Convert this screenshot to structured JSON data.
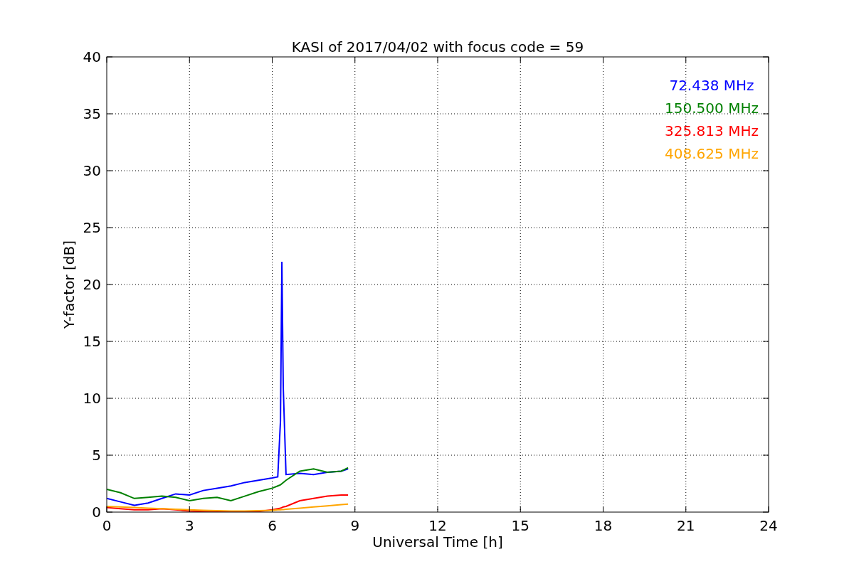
{
  "chart_data": {
    "type": "line",
    "title": "KASI of 2017/04/02 with focus code = 59",
    "xlabel": "Universal Time [h]",
    "ylabel": "Y-factor [dB]",
    "x": [
      0,
      0.5,
      1,
      1.5,
      2,
      2.5,
      3,
      3.5,
      4,
      4.5,
      5,
      5.5,
      6,
      6.2,
      6.3,
      6.35,
      6.4,
      6.5,
      7,
      7.5,
      8,
      8.5,
      8.75
    ],
    "series": [
      {
        "name": "72.438 MHz",
        "color": "#0000ff",
        "values": [
          1.2,
          0.9,
          0.6,
          0.8,
          1.2,
          1.6,
          1.5,
          1.9,
          2.1,
          2.3,
          2.6,
          2.8,
          3.0,
          3.1,
          8,
          22,
          11,
          3.3,
          3.4,
          3.3,
          3.5,
          3.6,
          3.8
        ]
      },
      {
        "name": "150.500 MHz",
        "color": "#008000",
        "values": [
          2.0,
          1.7,
          1.2,
          1.3,
          1.4,
          1.3,
          1.0,
          1.2,
          1.3,
          1.0,
          1.4,
          1.8,
          2.1,
          2.3,
          2.4,
          2.5,
          2.6,
          2.8,
          3.6,
          3.8,
          3.5,
          3.6,
          3.9
        ]
      },
      {
        "name": "325.813 MHz",
        "color": "#ff0000",
        "values": [
          0.4,
          0.3,
          0.2,
          0.2,
          0.3,
          0.2,
          0.1,
          0.05,
          0,
          0,
          0,
          0.05,
          0.2,
          0.3,
          0.35,
          0.4,
          0.45,
          0.5,
          1.0,
          1.2,
          1.4,
          1.5,
          1.5
        ]
      },
      {
        "name": "408.625 MHz",
        "color": "#ffa500",
        "values": [
          0.5,
          0.45,
          0.4,
          0.35,
          0.3,
          0.25,
          0.2,
          0.15,
          0.12,
          0.1,
          0.1,
          0.12,
          0.15,
          0.2,
          0.2,
          0.22,
          0.22,
          0.25,
          0.35,
          0.45,
          0.55,
          0.65,
          0.7
        ]
      }
    ],
    "grid": true,
    "xlim": [
      0,
      24
    ],
    "ylim": [
      0,
      40
    ],
    "xticks": [
      0,
      3,
      6,
      9,
      12,
      15,
      18,
      21,
      24
    ],
    "yticks": [
      0,
      5,
      10,
      15,
      20,
      25,
      30,
      35,
      40
    ]
  }
}
